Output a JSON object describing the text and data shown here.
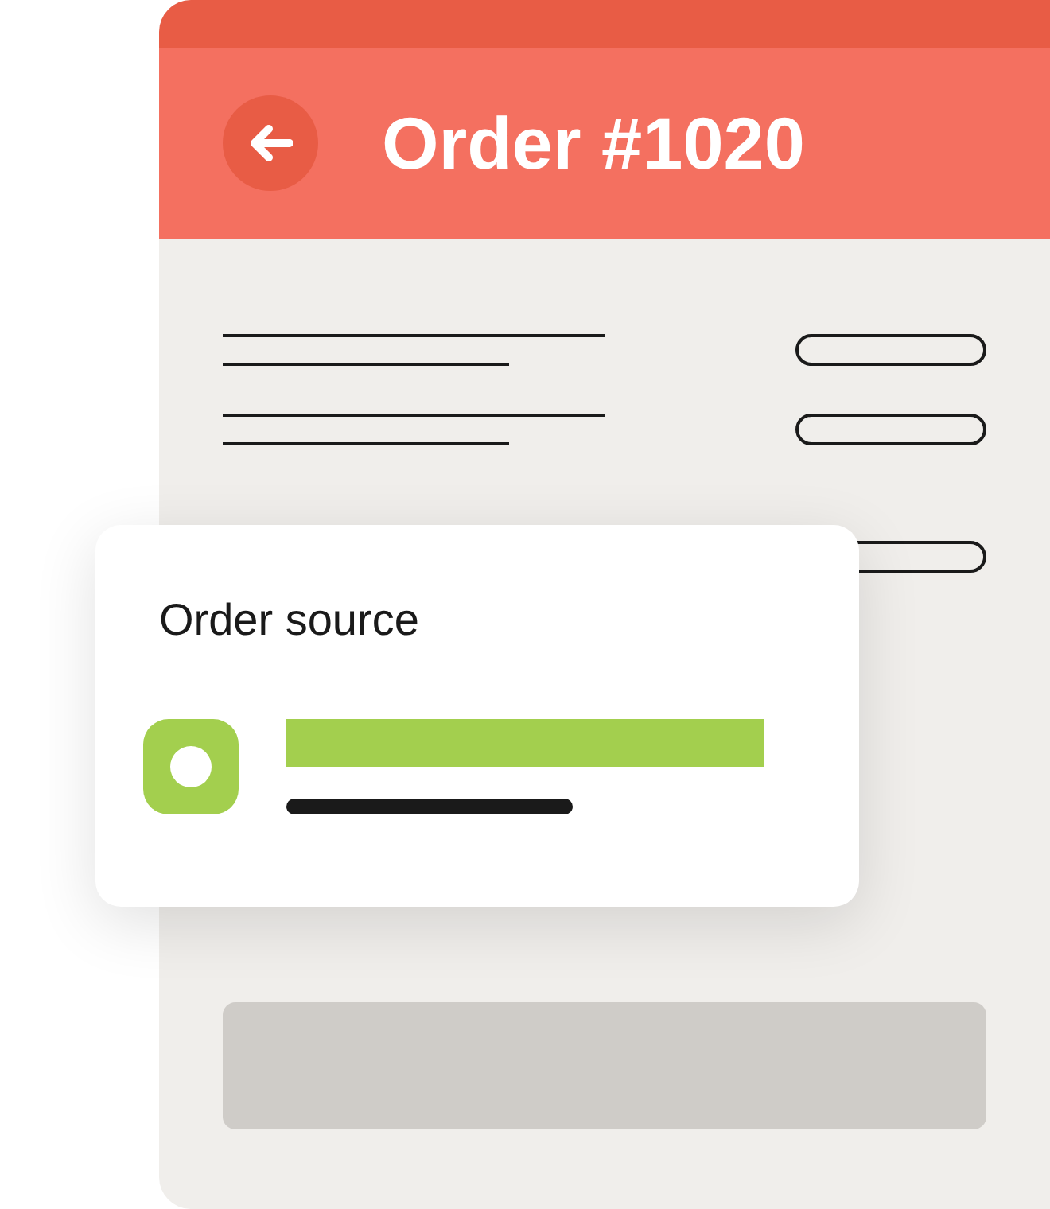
{
  "header": {
    "title": "Order #1020"
  },
  "card": {
    "title": "Order source"
  }
}
